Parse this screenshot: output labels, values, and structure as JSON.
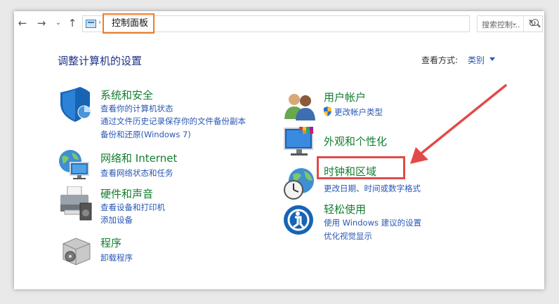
{
  "address_bar": {
    "breadcrumb": "控制面板",
    "search_placeholder": "搜索控制..."
  },
  "header": {
    "title": "调整计算机的设置",
    "view_by_label": "查看方式:",
    "view_by_value": "类别"
  },
  "categories": {
    "system_security": {
      "title": "系统和安全",
      "links": [
        "查看你的计算机状态",
        "通过文件历史记录保存你的文件备份副本",
        "备份和还原(Windows 7)"
      ]
    },
    "network": {
      "title": "网络和 Internet",
      "links": [
        "查看网络状态和任务"
      ]
    },
    "hardware": {
      "title": "硬件和声音",
      "links": [
        "查看设备和打印机",
        "添加设备"
      ]
    },
    "programs": {
      "title": "程序",
      "links": [
        "卸载程序"
      ]
    },
    "user_accounts": {
      "title": "用户帐户",
      "links": [
        "更改帐户类型"
      ]
    },
    "appearance": {
      "title": "外观和个性化",
      "links": []
    },
    "clock_region": {
      "title": "时钟和区域",
      "links": [
        "更改日期、时间或数字格式"
      ]
    },
    "ease_access": {
      "title": "轻松使用",
      "links": [
        "使用 Windows 建议的设置",
        "优化视觉显示"
      ]
    }
  },
  "colors": {
    "category_title": "#127d2f",
    "link": "#2857b5",
    "highlight": "#e24a4a",
    "breadcrumb_highlight": "#f07d24"
  }
}
